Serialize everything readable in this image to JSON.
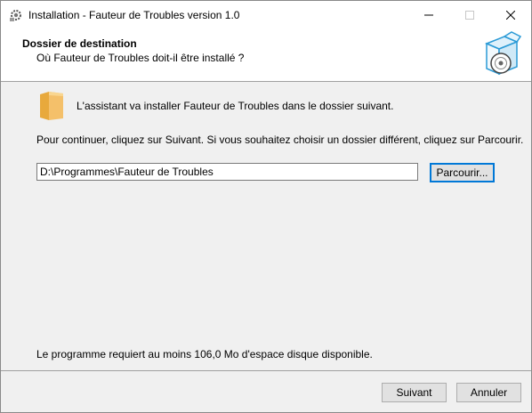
{
  "window": {
    "title": "Installation - Fauteur de Troubles version 1.0",
    "app_icon": "setup-gear-icon",
    "controls": {
      "minimize": "minimize-icon",
      "maximize": "maximize-icon",
      "close": "close-icon"
    }
  },
  "header": {
    "title": "Dossier de destination",
    "subtitle": "Où Fauteur de Troubles doit-il être installé ?",
    "icon": "box-with-disc-icon"
  },
  "main": {
    "folder_icon": "folder-icon",
    "intro": "L'assistant va installer Fauteur de Troubles dans le dossier suivant.",
    "instruction": "Pour continuer, cliquez sur Suivant. Si vous souhaitez choisir un dossier différent, cliquez sur Parcourir.",
    "path_value": "D:\\Programmes\\Fauteur de Troubles",
    "browse_label": "Parcourir...",
    "space_info": "Le programme requiert au moins 106,0 Mo d'espace disque disponible."
  },
  "footer": {
    "next_label": "Suivant",
    "cancel_label": "Annuler"
  },
  "colors": {
    "focus_border": "#0078d7",
    "panel_bg": "#f0f0f0",
    "folder_fill": "#f4c06a"
  }
}
